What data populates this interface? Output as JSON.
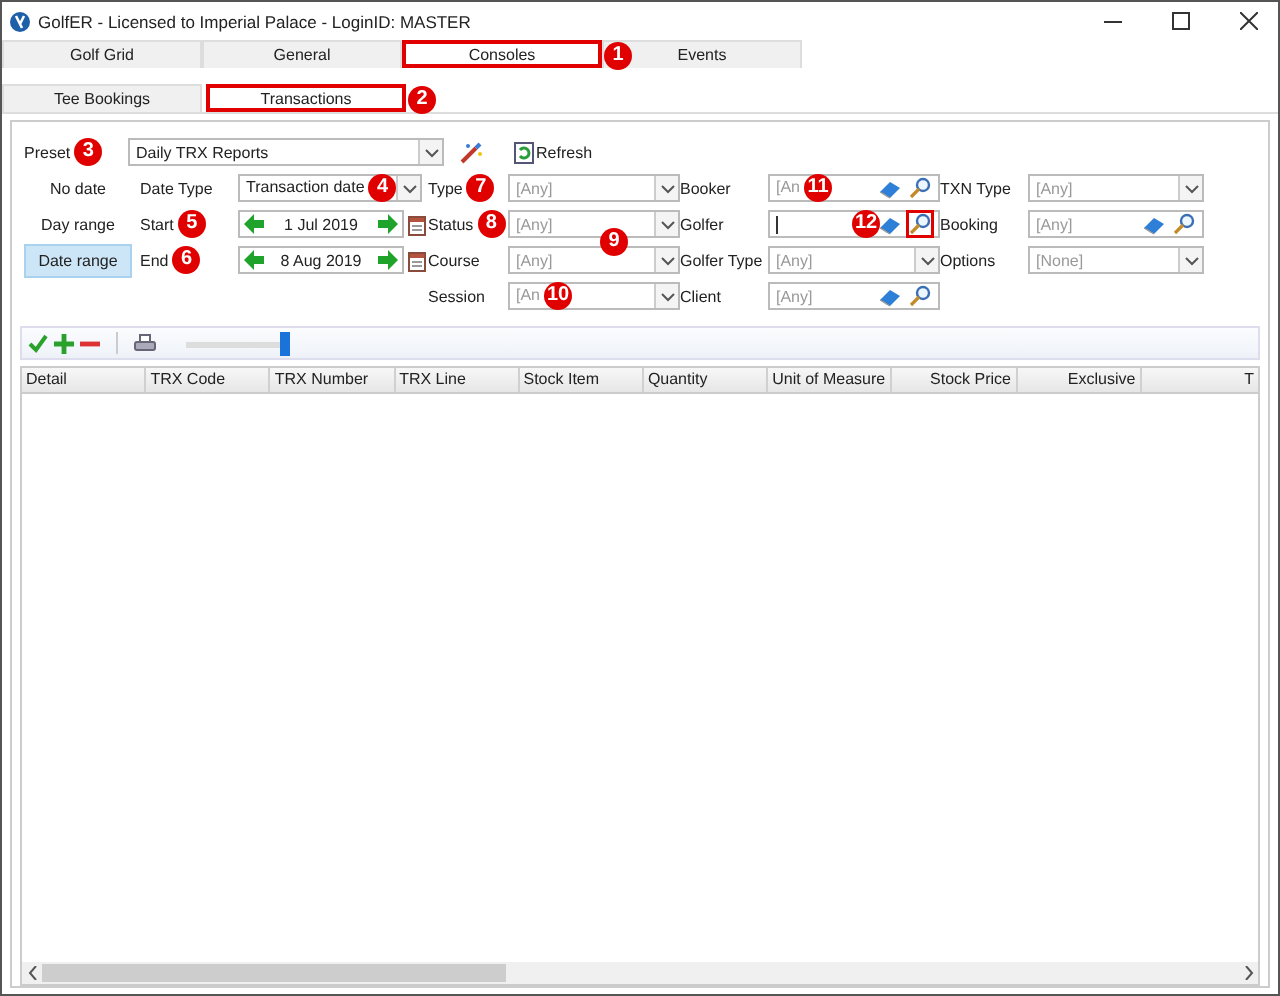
{
  "window": {
    "title": "GolfER - Licensed to Imperial Palace - LoginID: MASTER"
  },
  "tabs": [
    {
      "label": "Golf Grid",
      "selected": false,
      "highlighted": false
    },
    {
      "label": "General",
      "selected": false,
      "highlighted": false
    },
    {
      "label": "Consoles",
      "selected": true,
      "highlighted": true,
      "callout": "1"
    },
    {
      "label": "Events",
      "selected": false,
      "highlighted": false
    }
  ],
  "subtabs": [
    {
      "label": "Tee Bookings",
      "selected": false,
      "highlighted": false
    },
    {
      "label": "Transactions",
      "selected": true,
      "highlighted": true,
      "callout": "2"
    }
  ],
  "preset": {
    "label": "Preset",
    "callout": "3",
    "value": "Daily TRX Reports",
    "refresh": "Refresh"
  },
  "date_modes": [
    {
      "label": "No date",
      "selected": false
    },
    {
      "label": "Day range",
      "selected": false
    },
    {
      "label": "Date range",
      "selected": true
    }
  ],
  "filter_columns": [
    [
      {
        "label": "Date Type",
        "kind": "combo",
        "value": "Transaction date",
        "control_callout": "4"
      },
      {
        "label": "Start",
        "callout": "5",
        "kind": "date",
        "value": "1 Jul 2019"
      },
      {
        "label": "End",
        "callout": "6",
        "kind": "date",
        "value": "8 Aug 2019"
      }
    ],
    [
      {
        "label": "Type",
        "callout": "7",
        "kind": "combo",
        "placeholder": "[Any]"
      },
      {
        "label": "Status",
        "callout": "8",
        "kind": "combo",
        "placeholder": "[Any]"
      },
      {
        "label": "Course",
        "kind": "combo",
        "placeholder": "[Any]",
        "control_callout": "9"
      },
      {
        "label": "Session",
        "kind": "combo",
        "placeholder": "[An",
        "control_callout": "10"
      }
    ],
    [
      {
        "label": "Booker",
        "kind": "lookup",
        "placeholder": "[An",
        "search_highlighted": false,
        "control_callout": "11"
      },
      {
        "label": "Golfer",
        "kind": "lookup",
        "focused": true,
        "search_highlighted": true,
        "control_callout": "12"
      },
      {
        "label": "Golfer Type",
        "kind": "combo",
        "placeholder": "[Any]"
      },
      {
        "label": "Client",
        "kind": "lookup",
        "placeholder": "[Any]",
        "search_highlighted": false
      }
    ],
    [
      {
        "label": "TXN Type",
        "kind": "combo",
        "placeholder": "[Any]"
      },
      {
        "label": "Booking",
        "kind": "lookup",
        "placeholder": "[Any]",
        "search_highlighted": false
      },
      {
        "label": "Options",
        "kind": "combo",
        "placeholder": "[None]"
      }
    ]
  ],
  "slider": {
    "level": 1
  },
  "table": {
    "columns": [
      {
        "label": "Detail",
        "kind": "text"
      },
      {
        "label": "TRX Code",
        "kind": "text"
      },
      {
        "label": "TRX Number",
        "kind": "text"
      },
      {
        "label": "TRX Line",
        "kind": "text"
      },
      {
        "label": "Stock Item",
        "kind": "text"
      },
      {
        "label": "Quantity",
        "kind": "text"
      },
      {
        "label": "Unit of Measure",
        "kind": "text"
      },
      {
        "label": "Stock Price",
        "kind": "money"
      },
      {
        "label": "Exclusive",
        "kind": "money"
      },
      {
        "label": "T",
        "kind": "money"
      }
    ]
  }
}
